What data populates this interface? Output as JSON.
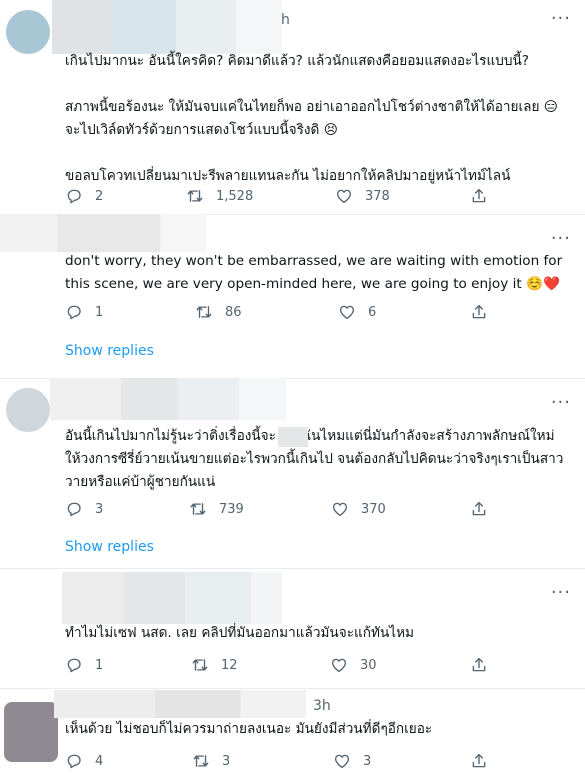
{
  "tweets": [
    {
      "text": "เกินไปมากนะ อันนี้ใครคิด? คิดมาดีแล้ว? แล้วนักแสดงคือยอมแสดงอะไรแบบนี้?\n\nสภาพนี้ขอร้องนะ ให้มันจบแค่ในไทยก็พอ อย่าเอาออกไปโชว์ต่างชาติให้ได้อายเลย 😑 จะไปเวิล์ดทัวร์ด้วยการแสดงโชว์แบบนี้จริงดิ 😣\n\nขอลบโควทเปลี่ยนมาเปะรีพลายแทนละกัน ไม่อยากให้คลิปมาอยู่หน้าไทม์ไลน์",
      "reply_count": "2",
      "retweet_count": "1,528",
      "like_count": "378",
      "timestamp_partial": "h"
    },
    {
      "text": "don't worry, they won't be embarrassed, we are waiting with emotion for this scene, we are very open-minded here, we are going to enjoy it ☺️❤️",
      "reply_count": "1",
      "retweet_count": "86",
      "like_count": "6",
      "show_replies": "Show replies"
    },
    {
      "text": "อันนี้เกินไปมากไม่รู้นะว่าติ่งเรื่องนี้จะ      ฉันไหมแต่นี่มันกำลังจะสร้างภาพลักษณ์ใหม่ให้วงการซีรี่ย์วายเน้นขายแต่อะไรพวกนี้เกินไป จนต้องกลับไปคิดนะว่าจริงๆเราเป็นสาววายหรือแค่บ้าผู้ชายกันแน่",
      "reply_count": "3",
      "retweet_count": "739",
      "like_count": "370",
      "show_replies": "Show replies"
    },
    {
      "text": "ทำไมไม่เซฟ นสด. เลย คลิปที่มันออกมาแล้วมันจะแก้ทันไหม",
      "reply_count": "1",
      "retweet_count": "12",
      "like_count": "30"
    },
    {
      "text": "เห็นด้วย ไม่ชอบก็ไม่ควรมาถ่ายลงเนอะ มันยังมีส่วนที่ดีๆอีกเยอะ",
      "reply_count": "4",
      "retweet_count": "3",
      "like_count": "3",
      "timestamp": "3h"
    }
  ],
  "icons": {
    "reply": "reply-icon",
    "retweet": "retweet-icon",
    "like": "heart-icon",
    "share": "share-icon",
    "more": "more-icon"
  },
  "colors": {
    "link": "#1d9bf0",
    "muted": "#536471",
    "divider": "#e6ecf0"
  }
}
